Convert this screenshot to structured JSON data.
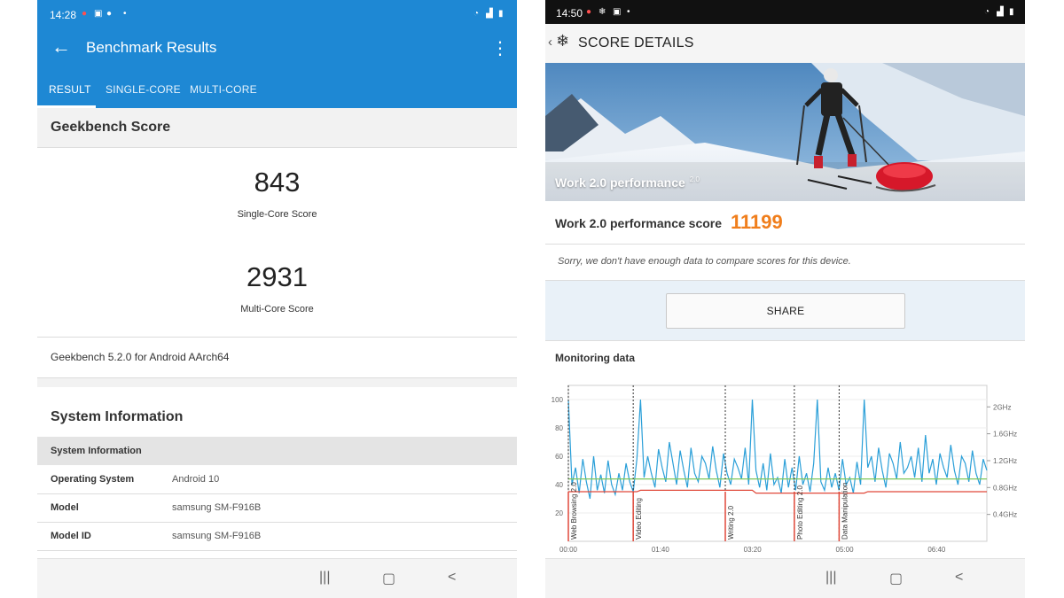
{
  "geekbench": {
    "status_time": "14:28",
    "title": "Benchmark Results",
    "tabs": [
      "RESULT",
      "SINGLE-CORE",
      "MULTI-CORE"
    ],
    "section_title": "Geekbench Score",
    "single_score": "843",
    "single_label": "Single-Core Score",
    "multi_score": "2931",
    "multi_label": "Multi-Core Score",
    "version": "Geekbench 5.2.0 for Android AArch64",
    "sysinfo_title": "System Information",
    "sysinfo_header": "System Information",
    "rows": [
      {
        "key": "Operating System",
        "value": "Android 10"
      },
      {
        "key": "Model",
        "value": "samsung SM-F916B"
      },
      {
        "key": "Model ID",
        "value": "samsung SM-F916B"
      }
    ],
    "accent": "#1e88d4"
  },
  "pcmark": {
    "status_time": "14:50",
    "title": "SCORE DETAILS",
    "hero_caption": "Work 2.0 performance",
    "hero_version": "2.0",
    "score_label": "Work 2.0 performance score",
    "score_value": "11199",
    "note": "Sorry, we don't have enough data to compare scores for this device.",
    "share_label": "SHARE",
    "monitoring_title": "Monitoring data",
    "accent": "#f07e1c"
  },
  "chart_data": {
    "type": "line",
    "y_left_ticks": [
      "20",
      "40",
      "60",
      "80",
      "100"
    ],
    "y_left_range": [
      0,
      110
    ],
    "y_right_ticks": [
      "0.4GHz",
      "0.8GHz",
      "1.2GHz",
      "1.6GHz",
      "2GHz"
    ],
    "x_ticks": [
      "00:00",
      "01:40",
      "03:20",
      "05:00",
      "06:40"
    ],
    "phases": [
      {
        "label": "Web Browsing 2.0",
        "t": 0
      },
      {
        "label": "Video Editing",
        "t": 0.155
      },
      {
        "label": "Writing 2.0",
        "t": 0.375
      },
      {
        "label": "Photo Editing 2.0",
        "t": 0.54
      },
      {
        "label": "Data Manipulation",
        "t": 0.647
      }
    ],
    "series": [
      {
        "name": "",
        "color": "#2a9fd8",
        "values": [
          100,
          40,
          52,
          34,
          58,
          42,
          30,
          60,
          36,
          47,
          34,
          57,
          40,
          33,
          48,
          36,
          55,
          42,
          35,
          58,
          100,
          45,
          60,
          48,
          38,
          65,
          52,
          42,
          70,
          55,
          40,
          64,
          50,
          38,
          66,
          48,
          42,
          60,
          55,
          44,
          67,
          50,
          38,
          62,
          48,
          40,
          58,
          52,
          44,
          66,
          40,
          100,
          50,
          38,
          55,
          36,
          62,
          40,
          45,
          34,
          58,
          38,
          52,
          36,
          60,
          40,
          48,
          35,
          55,
          100,
          42,
          36,
          52,
          38,
          48,
          36,
          58,
          40,
          45,
          34,
          56,
          40,
          100,
          52,
          60,
          42,
          66,
          50,
          38,
          62,
          55,
          44,
          70,
          48,
          52,
          60,
          45,
          66,
          42,
          75,
          48,
          58,
          40,
          62,
          52,
          45,
          68,
          50,
          40,
          60,
          55,
          42,
          64,
          48,
          40,
          58,
          50
        ]
      },
      {
        "name": "",
        "color": "#7ec85a",
        "values": [
          44,
          44,
          44,
          44,
          44,
          44,
          44,
          44,
          44,
          44,
          44,
          44,
          44,
          44,
          44,
          44,
          44,
          44,
          44,
          44,
          44,
          44,
          44,
          44,
          44,
          44,
          44,
          44,
          44,
          44,
          44,
          44,
          44,
          44,
          44,
          44,
          44,
          44,
          44,
          44,
          44,
          44,
          44,
          44,
          44,
          44,
          44,
          44,
          44,
          44,
          44,
          44,
          44,
          44,
          44,
          44,
          44,
          44,
          44,
          44,
          44,
          44,
          44,
          44,
          44,
          44,
          44,
          44,
          44,
          44,
          44,
          44,
          44,
          44,
          44,
          44,
          44,
          44,
          44,
          44,
          44,
          44,
          44,
          44,
          44,
          44,
          44,
          44,
          44,
          44,
          44,
          44,
          44,
          44,
          44,
          44,
          44,
          44,
          44,
          44,
          44,
          44,
          44,
          44,
          44,
          44,
          44,
          44,
          44,
          44,
          44,
          44,
          44,
          44,
          44,
          44,
          44,
          44
        ]
      },
      {
        "name": "",
        "color": "#e0493a",
        "values": [
          35,
          35,
          35,
          35,
          35,
          35,
          35,
          35,
          35,
          35,
          35,
          35,
          35,
          35,
          35,
          35,
          35,
          35,
          35,
          35,
          36,
          36,
          36,
          36,
          36,
          36,
          36,
          36,
          36,
          36,
          36,
          36,
          36,
          36,
          36,
          36,
          36,
          36,
          36,
          36,
          36,
          36,
          36,
          36,
          36,
          36,
          36,
          36,
          36,
          36,
          36,
          36,
          34,
          34,
          34,
          34,
          34,
          34,
          34,
          34,
          34,
          34,
          34,
          34,
          34,
          34,
          34,
          34,
          34,
          34,
          34,
          34,
          34,
          34,
          34,
          34,
          34,
          34,
          34,
          34,
          34,
          34,
          34,
          35,
          35,
          35,
          35,
          35,
          35,
          35,
          35,
          35,
          35,
          35,
          35,
          35,
          35,
          35,
          35,
          35,
          35,
          35,
          35,
          35,
          35,
          35,
          35,
          35,
          35,
          35,
          35,
          35,
          35,
          35,
          35,
          35,
          35
        ]
      }
    ]
  }
}
